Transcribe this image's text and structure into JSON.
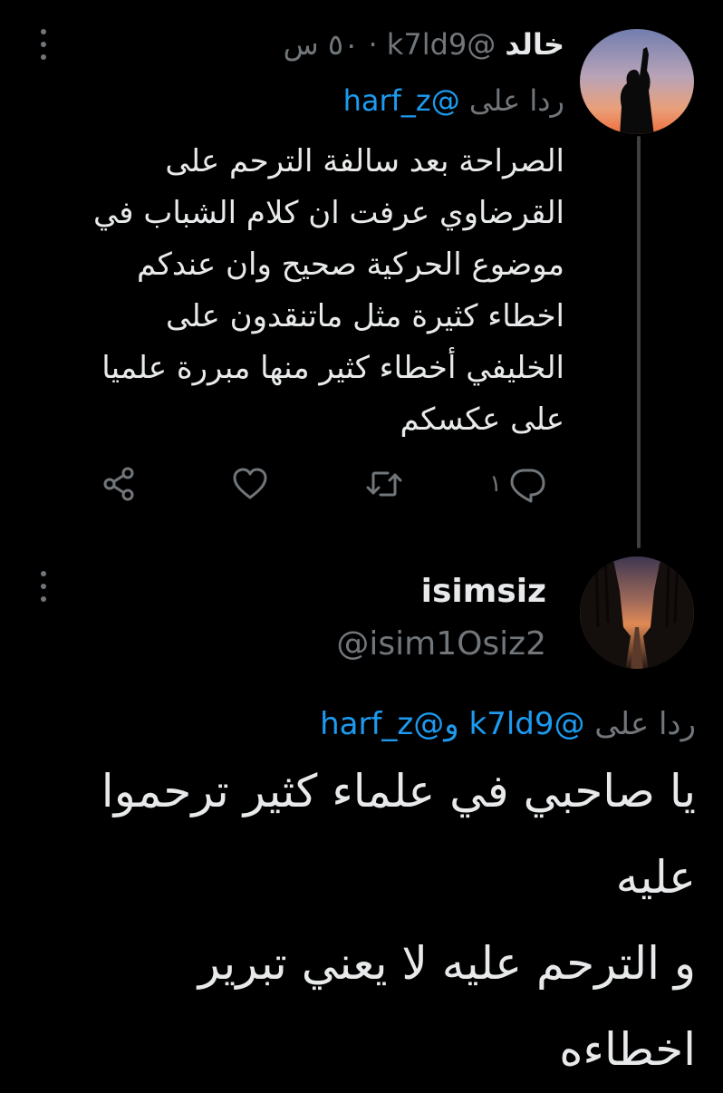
{
  "tweet1": {
    "display_name": "خالد",
    "handle": "@k7ld9",
    "separator": "·",
    "time": "٥٠ س",
    "reply_prefix": "ردا على",
    "reply_to": "@harf_z",
    "text": "الصراحة بعد سالفة الترحم على\nالقرضاوي عرفت ان كلام الشباب في\nموضوع الحركية صحيح وان عندكم\nاخطاء كثيرة مثل ماتنقدون على\nالخليفي أخطاء كثير منها مبررة علميا\nعلى عكسكم",
    "reply_count": "١",
    "icons": [
      "reply-icon",
      "retweet-icon",
      "like-icon",
      "share-icon",
      "more-icon"
    ],
    "avatar": "silhouette-sunset-avatar"
  },
  "tweet2": {
    "display_name": "isimsiz",
    "handle": "@isim1Osiz2",
    "reply_prefix": "ردا على",
    "reply_to_1": "@k7ld9",
    "reply_joiner": "و",
    "reply_to_2": "@harf_z",
    "text": "يا صاحبي في علماء كثير ترحموا\nعليه\nو الترحم عليه لا يعني تبرير\nاخطاءه",
    "avatar": "forest-road-sunset-avatar"
  },
  "colors": {
    "background": "#000000",
    "text": "#e7e9ea",
    "muted": "#71767b",
    "link": "#1d9bf0",
    "thread_line": "#3e4144"
  }
}
